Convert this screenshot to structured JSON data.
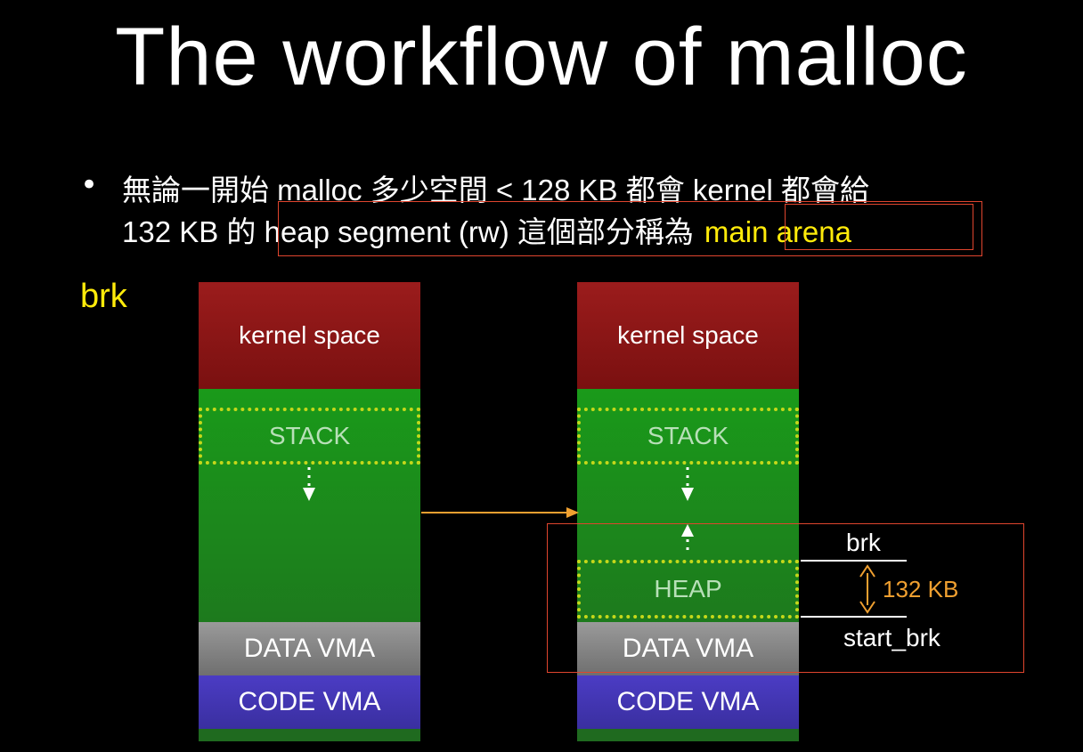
{
  "title": "The workflow of malloc",
  "bullet": {
    "dot": "•",
    "line1": "無論一開始 malloc 多少空間 < 128 KB 都會 kernel 都會給",
    "line2_prefix": "132 KB 的 ",
    "line2_mid": "heap segment (rw) 這個部分稱為",
    "line2_highlight": "main arena"
  },
  "side_label": "brk",
  "left_column": {
    "kernel": "kernel space",
    "stack": "STACK",
    "data": "DATA VMA",
    "code": "CODE VMA"
  },
  "right_column": {
    "kernel": "kernel space",
    "stack": "STACK",
    "heap": "HEAP",
    "data": "DATA VMA",
    "code": "CODE VMA"
  },
  "annotations": {
    "brk": "brk",
    "start_brk": "start_brk",
    "size": "132 KB"
  },
  "colors": {
    "background": "#000000",
    "highlight": "#ffeb0a",
    "kernel": "#8b1616",
    "green": "#1a8c1a",
    "data": "#888888",
    "code": "#4435b5",
    "red_box": "#e0452e",
    "arrow_orange": "#f0a030"
  }
}
